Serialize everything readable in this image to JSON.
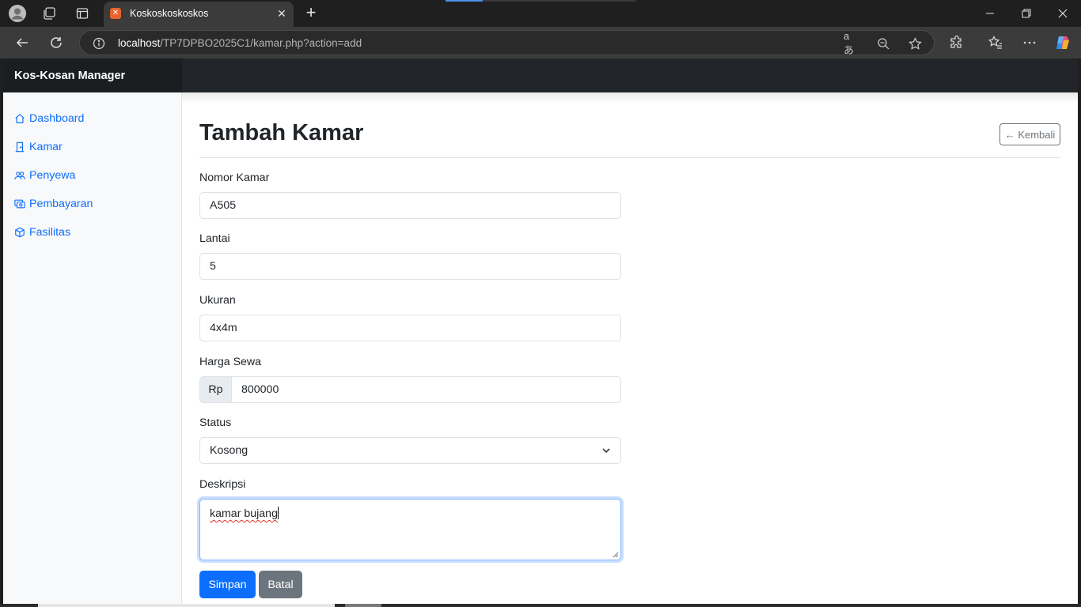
{
  "browser": {
    "tab_title": "Koskoskoskoskos",
    "tab_close": "✕",
    "new_tab": "+",
    "url_host": "localhost",
    "url_path": "/TP7DPBO2025C1/kamar.php?action=add",
    "read_aloud": "aあ"
  },
  "app": {
    "brand": "Kos-Kosan Manager"
  },
  "sidebar": {
    "items": [
      {
        "label": "Dashboard",
        "icon": "house-icon"
      },
      {
        "label": "Kamar",
        "icon": "door-icon"
      },
      {
        "label": "Penyewa",
        "icon": "people-icon"
      },
      {
        "label": "Pembayaran",
        "icon": "cash-icon"
      },
      {
        "label": "Fasilitas",
        "icon": "box-icon"
      }
    ]
  },
  "main": {
    "title": "Tambah Kamar",
    "back_label": "← Kembali",
    "form": {
      "nomor_label": "Nomor Kamar",
      "nomor_value": "A505",
      "lantai_label": "Lantai",
      "lantai_value": "5",
      "ukuran_label": "Ukuran",
      "ukuran_value": "4x4m",
      "harga_label": "Harga Sewa",
      "harga_prefix": "Rp",
      "harga_value": "800000",
      "status_label": "Status",
      "status_value": "Kosong",
      "deskripsi_label": "Deskripsi",
      "deskripsi_value": "kamar bujang",
      "submit_label": "Simpan",
      "cancel_label": "Batal"
    }
  },
  "colors": {
    "primary": "#0d6efd",
    "secondary": "#6c757d",
    "navbar": "#212529",
    "sidebar_bg": "#f8f9fa"
  }
}
